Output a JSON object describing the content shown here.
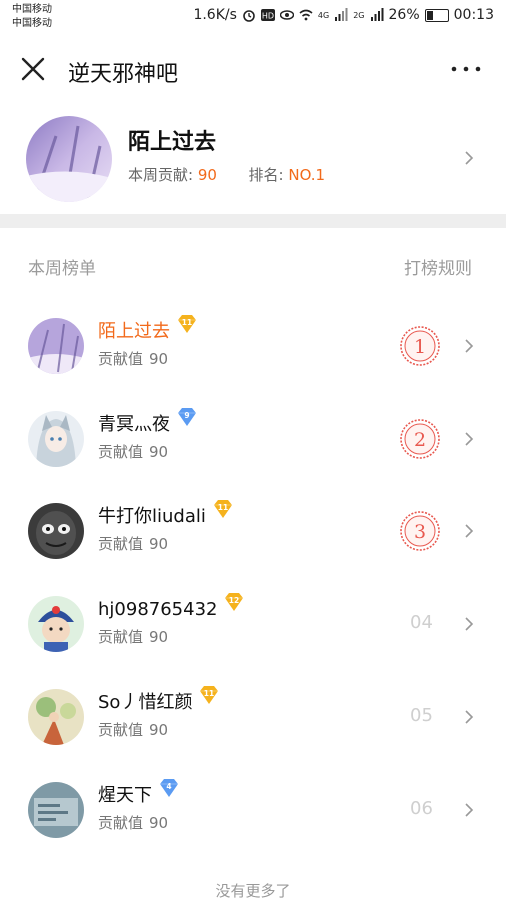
{
  "status_bar": {
    "carrier_1": "中国移动",
    "carrier_2": "中国移动",
    "speed": "1.6K/s",
    "network_4g": "4G",
    "network_2g": "2G",
    "battery": "26%",
    "time": "00:13"
  },
  "nav": {
    "title": "逆天邪神吧"
  },
  "user_card": {
    "name": "陌上过去",
    "weekly_label": "本周贡献:",
    "weekly_value": "90",
    "rank_label": "排名:",
    "rank_value": "NO.1"
  },
  "section": {
    "title": "本周榜单",
    "rules": "打榜规则"
  },
  "ranking": [
    {
      "name": "陌上过去",
      "level": "11",
      "badge": "gold",
      "score_label": "贡献值",
      "score": "90",
      "rank": "1",
      "avatar": "winter-scene"
    },
    {
      "name": "青冥灬夜",
      "level": "9",
      "badge": "blue",
      "score_label": "贡献值",
      "score": "90",
      "rank": "2",
      "avatar": "anime-girl"
    },
    {
      "name": "牛打你liudali",
      "level": "11",
      "badge": "gold",
      "score_label": "贡献值",
      "score": "90",
      "rank": "3",
      "avatar": "dark-face"
    },
    {
      "name": "hj098765432",
      "level": "12",
      "badge": "gold",
      "score_label": "贡献值",
      "score": "90",
      "rank": "04",
      "avatar": "cartoon-boy"
    },
    {
      "name": "So丿惜红颜",
      "level": "11",
      "badge": "gold",
      "score_label": "贡献值",
      "score": "90",
      "rank": "05",
      "avatar": "illustration"
    },
    {
      "name": "煋天下",
      "level": "4",
      "badge": "blue",
      "score_label": "贡献值",
      "score": "90",
      "rank": "06",
      "avatar": "blue-card"
    }
  ],
  "footer": {
    "text": "没有更多了"
  },
  "colors": {
    "accent": "#f26a1b",
    "rank_red": "#e8584f",
    "gold_badge": "#f5b21d",
    "blue_badge": "#5b9bf2"
  }
}
